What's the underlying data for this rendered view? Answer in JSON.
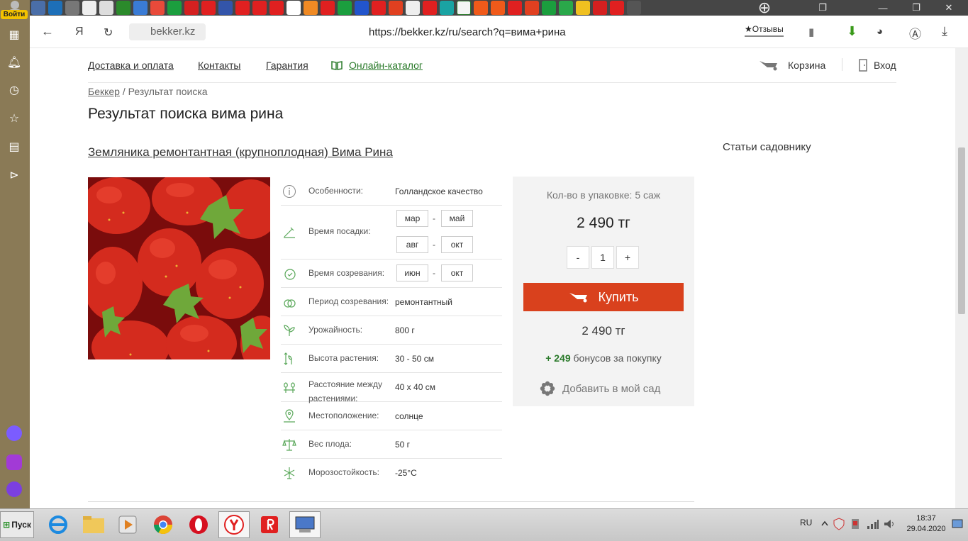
{
  "browser": {
    "login_label": "Войти",
    "site": "bekker.kz",
    "url": "https://bekker.kz/ru/search?q=вима+рина",
    "reviews": "Отзывы"
  },
  "site_nav": {
    "delivery": "Доставка и оплата",
    "contacts": "Контакты",
    "warranty": "Гарантия",
    "catalog": "Онлайн-каталог",
    "cart": "Корзина",
    "login": "Вход"
  },
  "breadcrumb": {
    "home": "Беккер",
    "sep": "/",
    "current": "Результат поиска"
  },
  "page_title": "Результат поиска вима рина",
  "product": {
    "title": "Земляника ремонтантная (крупноплодная) Вима Рина",
    "props": {
      "features_label": "Особенности:",
      "features_value": "Голландское качество",
      "planting_label": "Время посадки:",
      "planting_from1": "мар",
      "planting_to1": "май",
      "planting_from2": "авг",
      "planting_to2": "окт",
      "dash": "-",
      "ripening_label": "Время созревания:",
      "ripening_from": "июн",
      "ripening_to": "окт",
      "period_label": "Период созревания:",
      "period_value": "ремонтантный",
      "yield_label": "Урожайность:",
      "yield_value": "800 г",
      "height_label": "Высота растения:",
      "height_value": "30 - 50 см",
      "distance_label": "Расстояние между растениями:",
      "distance_value": "40 х 40 см",
      "location_label": "Местоположение:",
      "location_value": "солнце",
      "weight_label": "Вес плода:",
      "weight_value": "50 г",
      "frost_label": "Морозостойкость:",
      "frost_value": "-25°С"
    },
    "buy": {
      "pack_qty": "Кол-во в упаковке: 5 саж",
      "price": "2 490 тг",
      "minus": "-",
      "qty": "1",
      "plus": "+",
      "buy_label": "Купить",
      "total": "2 490 тг",
      "bonus_amount": "+ 249",
      "bonus_text": " бонусов за покупку",
      "add_garden": "Добавить в мой сад"
    }
  },
  "sidebar": {
    "articles": "Статьи садовнику"
  },
  "taskbar": {
    "start": "Пуск",
    "lang": "RU",
    "time": "18:37",
    "date": "29.04.2020"
  },
  "colors": {
    "accent": "#d9411d",
    "green": "#2a7a2a",
    "sidebar": "#8a7a56"
  }
}
